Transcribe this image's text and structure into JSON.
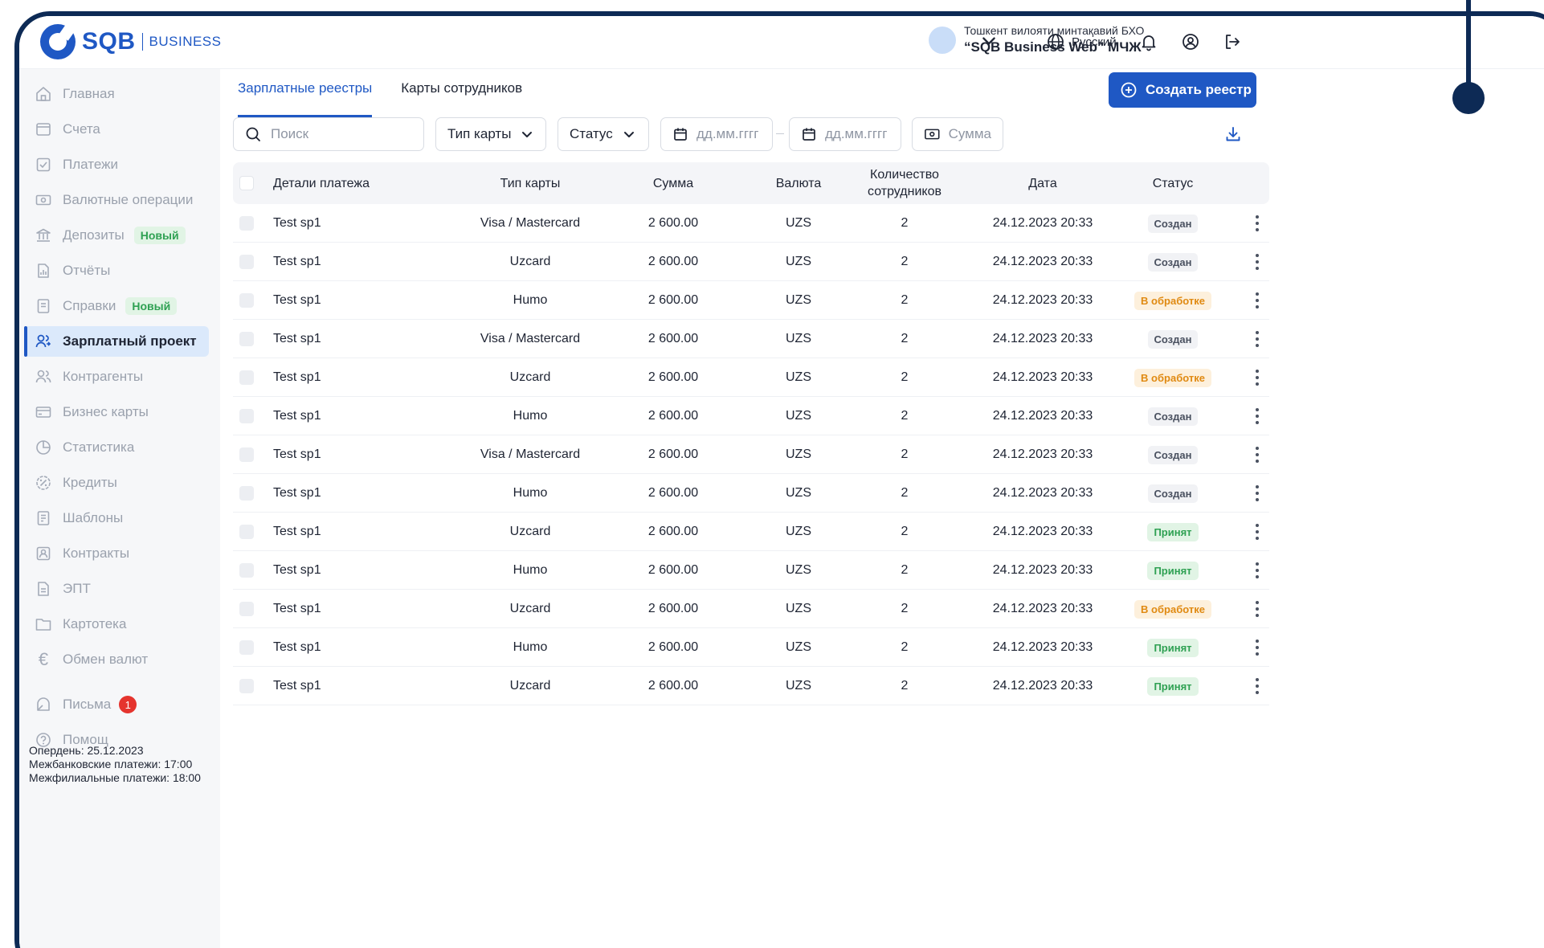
{
  "brand": {
    "name": "SQB",
    "sub": "BUSINESS",
    "accent": "#1f58c4"
  },
  "org": {
    "subtitle": "Тошкент вилояти минтақавий БХО",
    "title": "“SQB Business Web” МЧЖ"
  },
  "header": {
    "language": "Русский"
  },
  "sidebar": {
    "items": [
      {
        "label": "Главная",
        "icon": "home-icon"
      },
      {
        "label": "Счета",
        "icon": "wallet-icon"
      },
      {
        "label": "Платежи",
        "icon": "checkbox-icon"
      },
      {
        "label": "Валютные операции",
        "icon": "banknote-icon"
      },
      {
        "label": "Депозиты",
        "icon": "bank-icon",
        "badge": "Новый"
      },
      {
        "label": "Отчёты",
        "icon": "report-icon"
      },
      {
        "label": "Справки",
        "icon": "document-icon",
        "badge": "Новый"
      },
      {
        "label": "Зарплатный проект",
        "icon": "users-icon",
        "active": true
      },
      {
        "label": "Контрагенты",
        "icon": "people-icon"
      },
      {
        "label": "Бизнес карты",
        "icon": "card-icon"
      },
      {
        "label": "Статистика",
        "icon": "pie-chart-icon"
      },
      {
        "label": "Кредиты",
        "icon": "percent-icon"
      },
      {
        "label": "Шаблоны",
        "icon": "template-icon"
      },
      {
        "label": "Контракты",
        "icon": "contract-icon"
      },
      {
        "label": "ЭПТ",
        "icon": "file-icon"
      },
      {
        "label": "Картотека",
        "icon": "folder-icon"
      },
      {
        "label": "Обмен валют",
        "icon": "euro-icon"
      },
      {
        "label": "Письма",
        "icon": "letter-icon",
        "count": "1"
      },
      {
        "label": "Помощ",
        "icon": "help-icon"
      }
    ],
    "footer": {
      "line1": "Опердень: 25.12.2023",
      "line2": "Межбанковские платежи: 17:00",
      "line3": "Межфилиальные платежи: 18:00"
    }
  },
  "tabs": [
    {
      "label": "Зарплатные реестры",
      "active": true
    },
    {
      "label": "Карты сотрудников"
    }
  ],
  "create_button": "Создать реестр",
  "filters": {
    "search_placeholder": "Поиск",
    "card_type": "Тип карты",
    "status": "Статус",
    "date_from": "дд.мм.гггг",
    "date_to": "дд.мм.гггг",
    "amount": "Сумма"
  },
  "table": {
    "columns": [
      "Детали платежа",
      "Тип карты",
      "Сумма",
      "Валюта",
      "Количество сотрудников",
      "Дата",
      "Статус"
    ],
    "rows": [
      {
        "details": "Test sp1",
        "card": "Visa / Mastercard",
        "amount": "2 600.00",
        "currency": "UZS",
        "employees": "2",
        "date": "24.12.2023 20:33",
        "status": "Создан",
        "status_type": "created"
      },
      {
        "details": "Test sp1",
        "card": "Uzcard",
        "amount": "2 600.00",
        "currency": "UZS",
        "employees": "2",
        "date": "24.12.2023 20:33",
        "status": "Создан",
        "status_type": "created"
      },
      {
        "details": "Test sp1",
        "card": "Humo",
        "amount": "2 600.00",
        "currency": "UZS",
        "employees": "2",
        "date": "24.12.2023 20:33",
        "status": "В обработке",
        "status_type": "processing"
      },
      {
        "details": "Test sp1",
        "card": "Visa / Mastercard",
        "amount": "2 600.00",
        "currency": "UZS",
        "employees": "2",
        "date": "24.12.2023 20:33",
        "status": "Создан",
        "status_type": "created"
      },
      {
        "details": "Test sp1",
        "card": "Uzcard",
        "amount": "2 600.00",
        "currency": "UZS",
        "employees": "2",
        "date": "24.12.2023 20:33",
        "status": "В обработке",
        "status_type": "processing"
      },
      {
        "details": "Test sp1",
        "card": "Humo",
        "amount": "2 600.00",
        "currency": "UZS",
        "employees": "2",
        "date": "24.12.2023 20:33",
        "status": "Создан",
        "status_type": "created"
      },
      {
        "details": "Test sp1",
        "card": "Visa / Mastercard",
        "amount": "2 600.00",
        "currency": "UZS",
        "employees": "2",
        "date": "24.12.2023 20:33",
        "status": "Создан",
        "status_type": "created"
      },
      {
        "details": "Test sp1",
        "card": "Humo",
        "amount": "2 600.00",
        "currency": "UZS",
        "employees": "2",
        "date": "24.12.2023 20:33",
        "status": "Создан",
        "status_type": "created"
      },
      {
        "details": "Test sp1",
        "card": "Uzcard",
        "amount": "2 600.00",
        "currency": "UZS",
        "employees": "2",
        "date": "24.12.2023 20:33",
        "status": "Принят",
        "status_type": "accepted"
      },
      {
        "details": "Test sp1",
        "card": "Humo",
        "amount": "2 600.00",
        "currency": "UZS",
        "employees": "2",
        "date": "24.12.2023 20:33",
        "status": "Принят",
        "status_type": "accepted"
      },
      {
        "details": "Test sp1",
        "card": "Uzcard",
        "amount": "2 600.00",
        "currency": "UZS",
        "employees": "2",
        "date": "24.12.2023 20:33",
        "status": "В обработке",
        "status_type": "processing"
      },
      {
        "details": "Test sp1",
        "card": "Humo",
        "amount": "2 600.00",
        "currency": "UZS",
        "employees": "2",
        "date": "24.12.2023 20:33",
        "status": "Принят",
        "status_type": "accepted"
      },
      {
        "details": "Test sp1",
        "card": "Uzcard",
        "amount": "2 600.00",
        "currency": "UZS",
        "employees": "2",
        "date": "24.12.2023 20:33",
        "status": "Принят",
        "status_type": "accepted"
      }
    ]
  }
}
